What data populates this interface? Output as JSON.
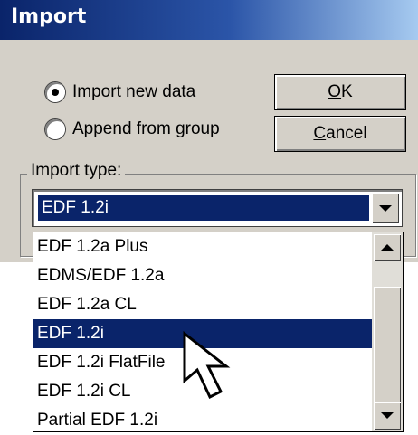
{
  "dialog": {
    "title": "Import",
    "options": [
      {
        "label": "Import new data",
        "selected": true
      },
      {
        "label": "Append from group",
        "selected": false
      }
    ],
    "buttons": {
      "ok": {
        "underlined": "O",
        "rest": "K"
      },
      "cancel": {
        "underlined": "C",
        "rest": "ancel"
      }
    },
    "import_type": {
      "label": "Import type:",
      "value": "EDF 1.2i",
      "items": [
        "EDF 1.2a Plus",
        "EDMS/EDF 1.2a",
        "EDF 1.2a CL",
        "EDF 1.2i",
        "EDF 1.2i FlatFile",
        "EDF 1.2i CL",
        "Partial EDF 1.2i"
      ],
      "selected_index": 3
    }
  },
  "colors": {
    "title_bar": "#0a246a",
    "selection": "#0a246a",
    "face": "#d4d0c8"
  },
  "icons": [
    "radio-button-icon",
    "dropdown-arrow-icon",
    "scroll-up-arrow-icon",
    "scroll-down-arrow-icon",
    "mouse-pointer-icon"
  ]
}
